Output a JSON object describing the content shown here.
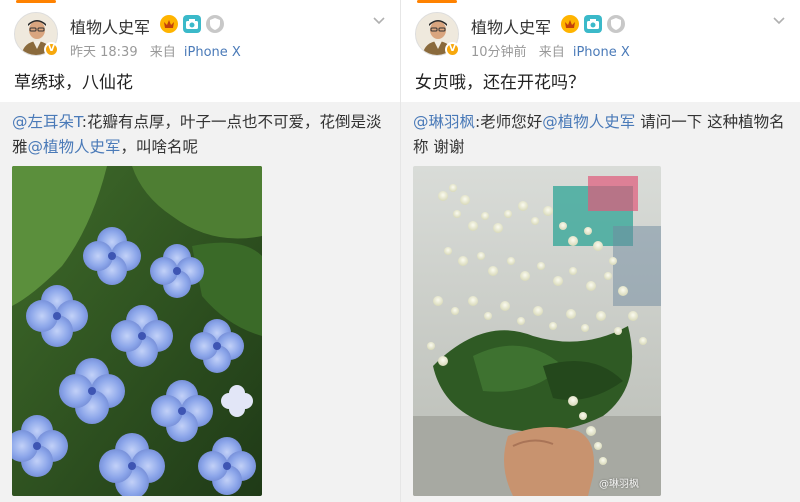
{
  "posts": [
    {
      "username": "植物人史军",
      "time": "昨天 18:39",
      "source_prefix": "来自",
      "source": "iPhone X",
      "text": "草绣球，八仙花",
      "repost": {
        "mention": "@左耳朵T",
        "text_a": ":花瓣有点厚，叶子一点也不可爱，花倒是淡雅",
        "mention2": "@植物人史军",
        "text_b": "，叫啥名呢"
      },
      "photo": "hydrangea-photo"
    },
    {
      "username": "植物人史军",
      "time": "10分钟前",
      "source_prefix": "来自",
      "source": "iPhone X",
      "text": "女贞哦，还在开花吗？",
      "repost": {
        "mention": "@琳羽枫",
        "text_a": ":老师您好",
        "mention2": "@植物人史军",
        "text_b": " 请问一下 这种植物名称 谢谢"
      },
      "photo": "privet-photo",
      "watermark": "@琳羽枫"
    }
  ],
  "colors": {
    "accent": "#ff8200",
    "link": "#4a7ab8",
    "meta": "#999999",
    "repost_bg": "#f2f2f2"
  },
  "icons": [
    "verified-v-icon",
    "vip-badge-icon",
    "camera-badge-icon",
    "shield-badge-icon",
    "chevron-down-icon"
  ]
}
